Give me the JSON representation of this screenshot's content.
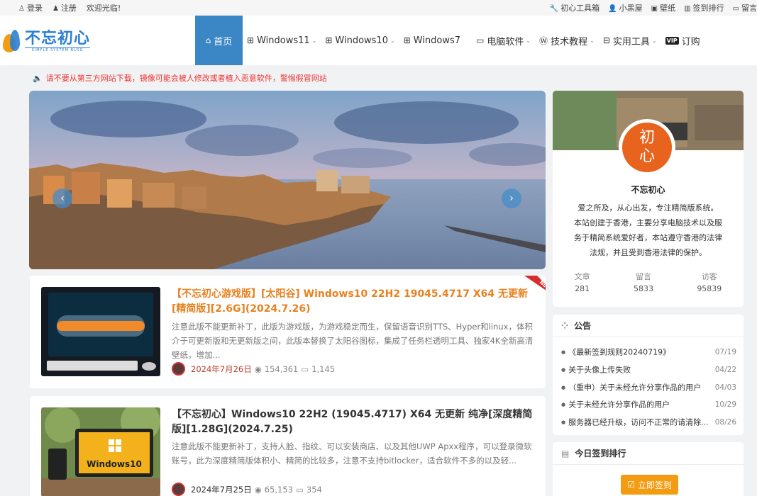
{
  "topbar": {
    "login": "登录",
    "register": "注册",
    "welcome": "欢迎光临!",
    "links": [
      "初心工具箱",
      "小黑屋",
      "壁纸",
      "签到排行",
      "留言"
    ]
  },
  "logo": {
    "cn": "不忘初心",
    "en": "SIMPLE SYSTEM BLOG"
  },
  "nav": [
    {
      "label": "首页",
      "icon": "home-icon",
      "active": true
    },
    {
      "label": "Windows11",
      "icon": "windows-icon",
      "caret": true
    },
    {
      "label": "Windows10",
      "icon": "windows-icon",
      "caret": true
    },
    {
      "label": "Windows7",
      "icon": "windows-icon"
    },
    {
      "label": "电脑软件",
      "icon": "monitor-icon",
      "caret": true
    },
    {
      "label": "技术教程",
      "icon": "wordpress-icon",
      "caret": true
    },
    {
      "label": "实用工具",
      "icon": "toolbox-icon",
      "caret": true
    },
    {
      "label": "订购",
      "icon": "vip-icon",
      "badge": "VIP"
    }
  ],
  "notice": "请不要从第三方网站下载，镜像可能会被人修改或者植入恶意软件，警惕假冒网站",
  "posts": [
    {
      "title": "【不忘初心游戏版】[太阳谷] Windows10 22H2 19045.4717 X64 无更新[精简版][2.6G](2024.7.26)",
      "excerpt": "注意此版不能更新补丁，此版为游戏版，为游戏稳定而生，保留语音识别TTS、Hyper和linux，体积介于可更新版和无更新版之间，此版本替换了太阳谷图标，集成了任务栏透明工具、独家4K全新高清壁纸，增加...",
      "date": "2024年7月26日",
      "views": "154,361",
      "comments": "1,145",
      "badge": "NEW"
    },
    {
      "title": "【不忘初心】Windows10 22H2 (19045.4717) X64 无更新 纯净[深度精简版][1.28G](2024.7.25)",
      "excerpt": "注意此版不能更新补丁，支持人脸、指纹、可以安装商店、以及其他UWP Apxx程序，可以登录微软账号，此为深度精简版体积小、精简的比较多，注意不支持bitlocker，适合软件不多的以及轻...",
      "date": "2024年7月25日",
      "views": "65,153",
      "comments": "354",
      "thumb_label": "Windows10"
    }
  ],
  "profile": {
    "avatar_text": [
      "初",
      "心"
    ],
    "name": "不忘初心",
    "desc": [
      "爱之所及，从心出发，专注精简版系统。",
      "本站创建于香港，主要分享电脑技术以及服",
      "务于精简系统爱好者，本站遵守香港的法律",
      "法规，并且受到香港法律的保护。"
    ],
    "stats": [
      {
        "label": "文章",
        "value": "281"
      },
      {
        "label": "留言",
        "value": "5833"
      },
      {
        "label": "访客",
        "value": "95839"
      }
    ]
  },
  "announce": {
    "title": "公告",
    "items": [
      {
        "text": "《最新签到规则20240719》",
        "date": "07/19"
      },
      {
        "text": "关于头像上传失败",
        "date": "04/22"
      },
      {
        "text": "（重申）关于未经允许分享作品的用户",
        "date": "04/03"
      },
      {
        "text": "关于未经允许分享作品的用户",
        "date": "10/29"
      },
      {
        "text": "服务器已经升级，访问不正常的请清除...",
        "date": "08/26"
      }
    ]
  },
  "signin": {
    "title": "今日签到排行",
    "button": "立即签到"
  },
  "colors": {
    "accent": "#3b86c5",
    "orange": "#e8811f",
    "red": "#e33333",
    "sign": "#f39c12"
  }
}
